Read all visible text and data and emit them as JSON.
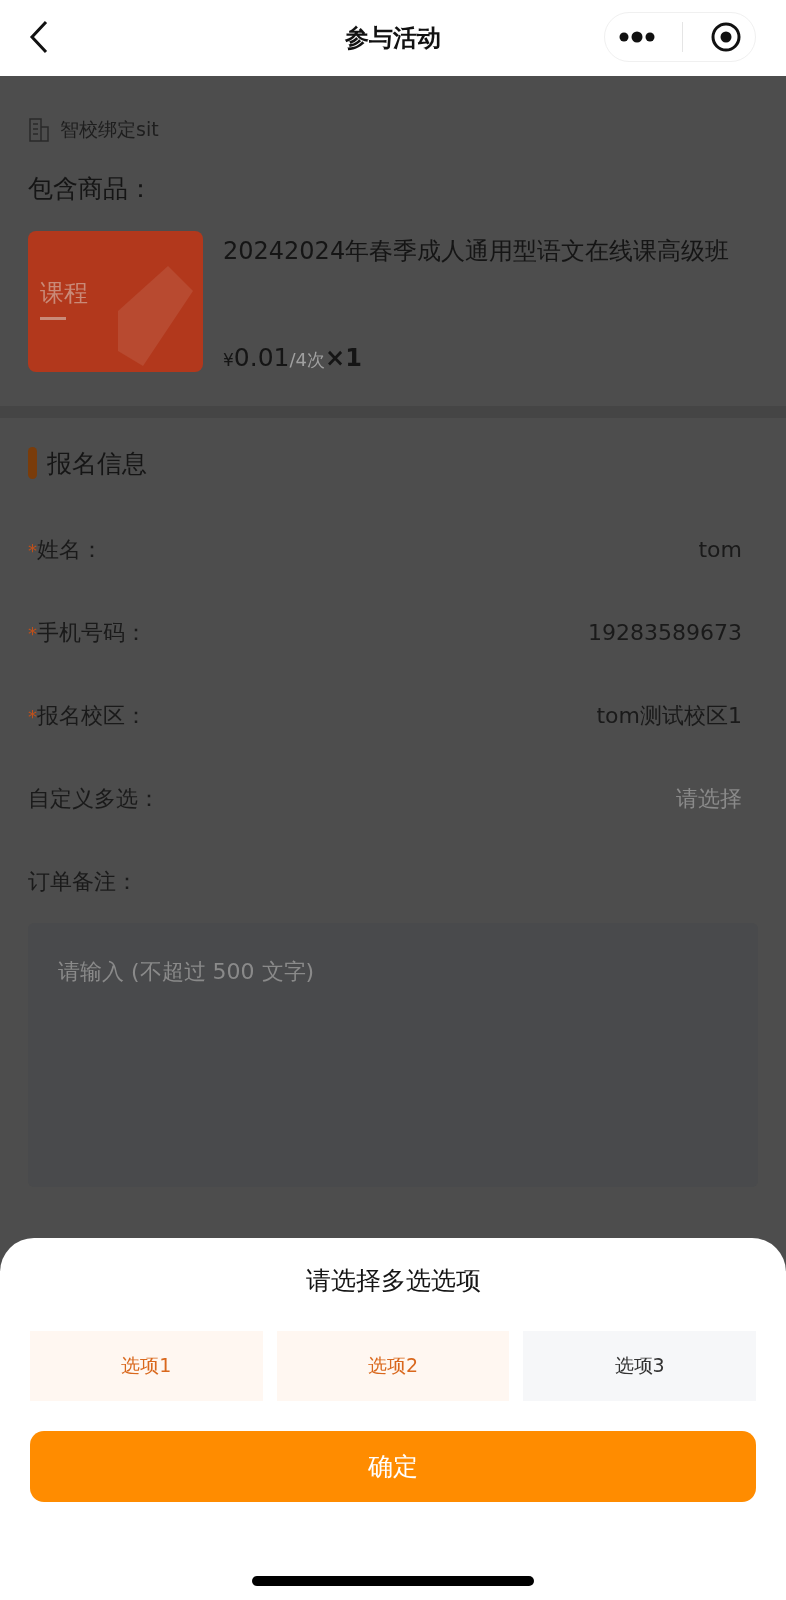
{
  "header": {
    "title": "参与活动"
  },
  "store": {
    "name": "智校绑定sit"
  },
  "products": {
    "heading": "包含商品：",
    "items": [
      {
        "image_label": "课程",
        "name": "20242024年春季成人通用型语文在线课高级班",
        "currency": "¥",
        "price": "0.01",
        "unit": "/4次",
        "quantity": "×1"
      }
    ]
  },
  "form": {
    "section_title": "报名信息",
    "fields": [
      {
        "kind": "text",
        "required_mark": "*",
        "label": "姓名：",
        "value": "tom"
      },
      {
        "kind": "text",
        "required_mark": "*",
        "label": "手机号码：",
        "value": "19283589673"
      },
      {
        "kind": "text",
        "required_mark": "*",
        "label": "报名校区：",
        "value": "tom测试校区1"
      },
      {
        "kind": "select",
        "label": "自定义多选：",
        "placeholder": "请选择"
      },
      {
        "kind": "textarea",
        "label": "订单备注：",
        "placeholder": "请输入 (不超过 500 文字)"
      }
    ]
  },
  "sheet": {
    "title": "请选择多选选项",
    "options": [
      {
        "label": "选项1",
        "selected": true
      },
      {
        "label": "选项2",
        "selected": true
      },
      {
        "label": "选项3",
        "selected": false
      }
    ],
    "confirm": "确定"
  }
}
